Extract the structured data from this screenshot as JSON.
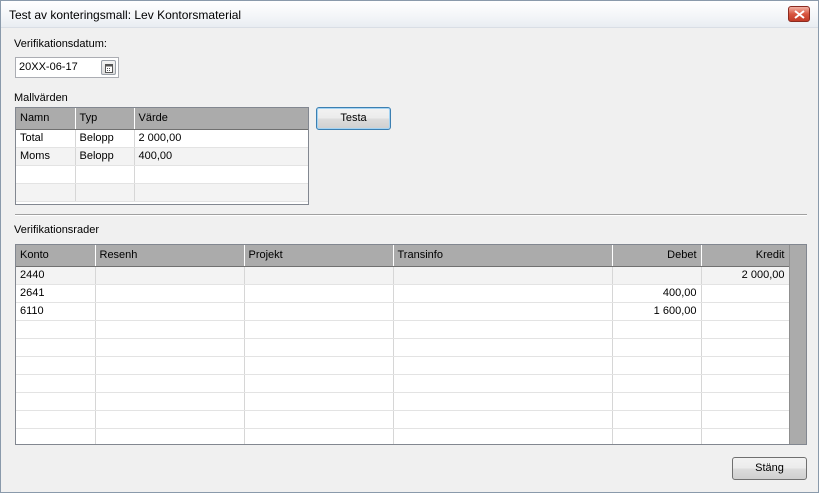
{
  "window": {
    "title": "Test av konteringsmall: Lev Kontorsmaterial"
  },
  "date_field": {
    "label": "Verifikationsdatum:",
    "value": "20XX-06-17"
  },
  "template_values": {
    "label": "Mallvärden",
    "columns": [
      "Namn",
      "Typ",
      "Värde"
    ],
    "rows": [
      [
        "Total",
        "Belopp",
        "2 000,00"
      ],
      [
        "Moms",
        "Belopp",
        "400,00"
      ],
      [
        "",
        "",
        ""
      ],
      [
        "",
        "",
        ""
      ]
    ]
  },
  "test_button": {
    "label": "Testa"
  },
  "verification_rows": {
    "label": "Verifikationsrader",
    "columns": [
      "Konto",
      "Resenh",
      "Projekt",
      "Transinfo",
      "Debet",
      "Kredit"
    ],
    "rows": [
      [
        "2440",
        "",
        "",
        "",
        "",
        "2 000,00"
      ],
      [
        "2641",
        "",
        "",
        "",
        "400,00",
        ""
      ],
      [
        "6110",
        "",
        "",
        "",
        "1 600,00",
        ""
      ],
      [
        "",
        "",
        "",
        "",
        "",
        ""
      ],
      [
        "",
        "",
        "",
        "",
        "",
        ""
      ],
      [
        "",
        "",
        "",
        "",
        "",
        ""
      ],
      [
        "",
        "",
        "",
        "",
        "",
        ""
      ],
      [
        "",
        "",
        "",
        "",
        "",
        ""
      ],
      [
        "",
        "",
        "",
        "",
        "",
        ""
      ],
      [
        "",
        "",
        "",
        "",
        "",
        ""
      ]
    ]
  },
  "close_button": {
    "label": "Stäng"
  },
  "icons": {
    "close": "close-icon",
    "calendar": "calendar-icon"
  }
}
